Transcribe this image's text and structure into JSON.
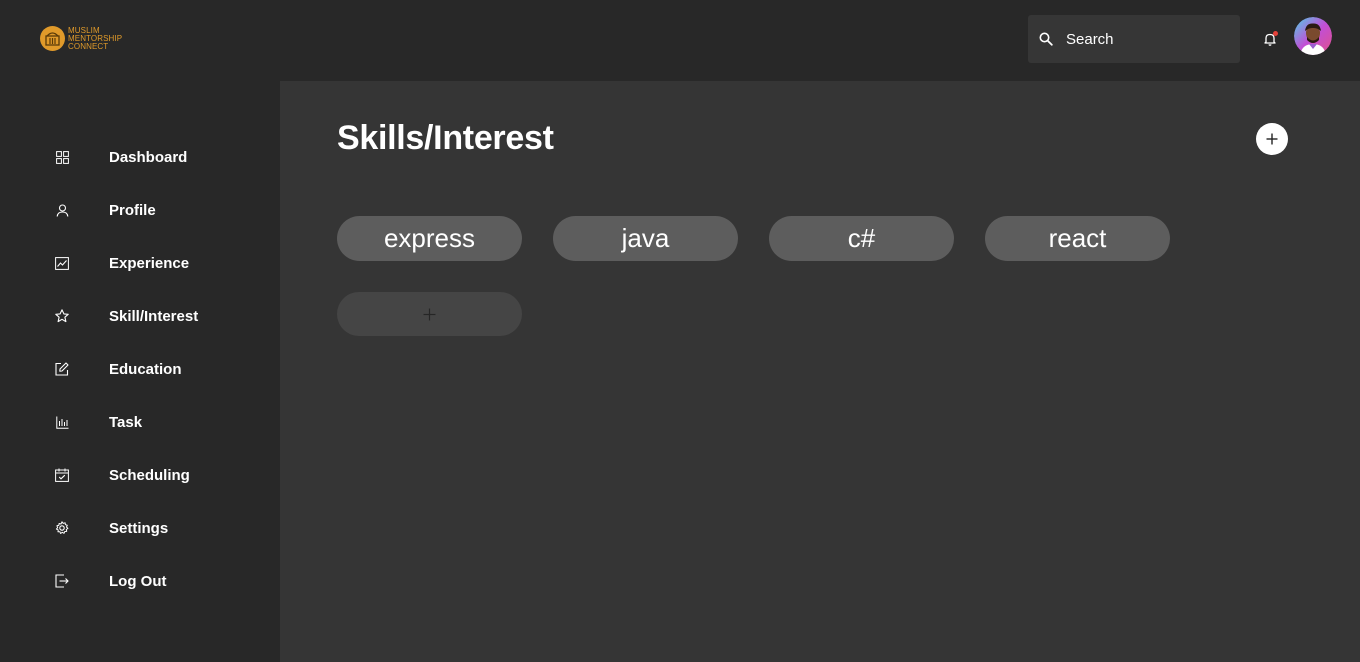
{
  "brand": {
    "line1": "Muslim",
    "line2": "Mentorship",
    "line3": "Connect",
    "color": "#e09a2a"
  },
  "header": {
    "search_placeholder": "Search",
    "notification_icon": "bell-icon",
    "notification_badge_color": "#e5413a"
  },
  "sidebar": {
    "items": [
      {
        "label": "Dashboard",
        "icon": "grid-icon"
      },
      {
        "label": "Profile",
        "icon": "user-icon"
      },
      {
        "label": "Experience",
        "icon": "chart-line-icon"
      },
      {
        "label": "Skill/Interest",
        "icon": "star-icon"
      },
      {
        "label": "Education",
        "icon": "edit-icon"
      },
      {
        "label": "Task",
        "icon": "bar-chart-icon"
      },
      {
        "label": "Scheduling",
        "icon": "calendar-icon"
      },
      {
        "label": "Settings",
        "icon": "gear-icon"
      },
      {
        "label": "Log Out",
        "icon": "logout-icon"
      }
    ]
  },
  "main": {
    "title": "Skills/Interest",
    "add_icon": "plus-icon",
    "skills": [
      "express",
      "java",
      "c#",
      "react"
    ],
    "add_skill_icon": "plus-icon"
  },
  "colors": {
    "background": "#282828",
    "content": "#353535",
    "chip": "#5d5d5d",
    "chip_add": "#454545"
  }
}
